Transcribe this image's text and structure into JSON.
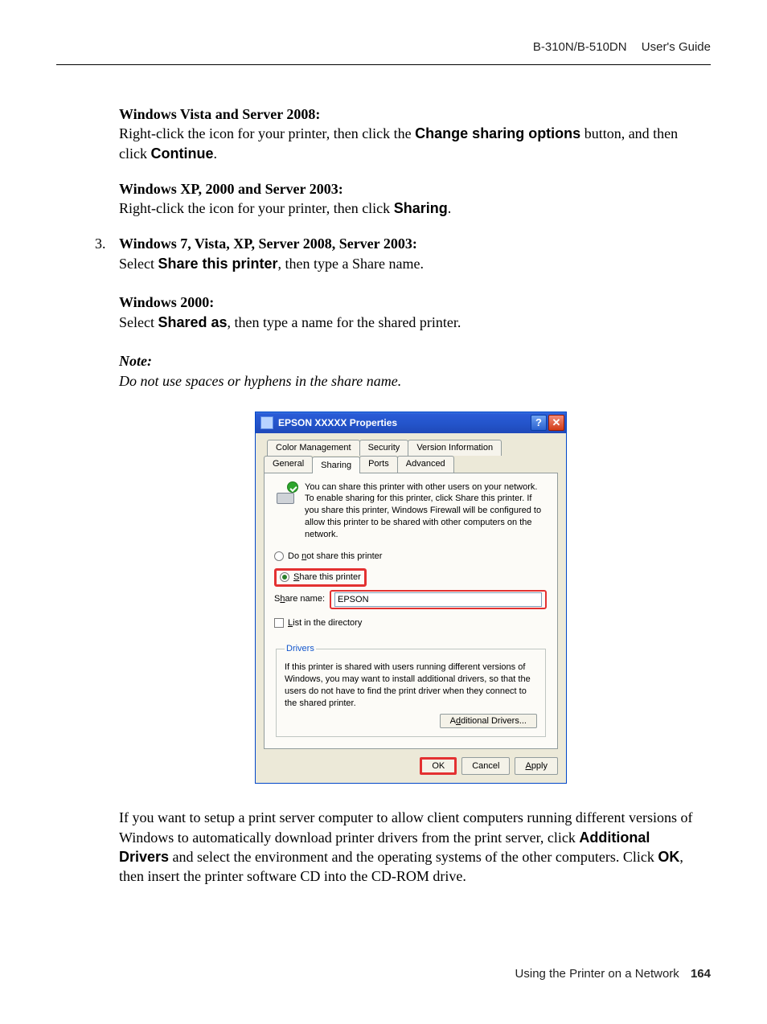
{
  "header": {
    "product": "B-310N/B-510DN",
    "title": "User's Guide"
  },
  "sectionA": {
    "heading": "Windows Vista and Server 2008:",
    "text_pre": "Right-click the icon for your printer, then click the ",
    "button1": "Change sharing options",
    "text_mid": " button, and then click ",
    "button2": "Continue",
    "text_post": "."
  },
  "sectionB": {
    "heading": "Windows XP, 2000 and Server 2003:",
    "text_pre": "Right-click the icon for your printer, then click ",
    "button1": "Sharing",
    "text_post": "."
  },
  "item3": {
    "number": "3.",
    "headingC": "Windows 7, Vista, XP, Server 2008, Server 2003:",
    "c_pre": "Select ",
    "c_bold": "Share this printer",
    "c_post": ", then type a Share name.",
    "headingD": "Windows 2000:",
    "d_pre": "Select ",
    "d_bold": "Shared as",
    "d_post": ", then type a name for the shared printer.",
    "note_label": "Note:",
    "note_text": "Do not use spaces or hyphens in the share name."
  },
  "dialog": {
    "title": "EPSON  XXXXX  Properties",
    "tabs_row1": [
      "Color Management",
      "Security",
      "Version Information"
    ],
    "tabs_row2": [
      "General",
      "Sharing",
      "Ports",
      "Advanced"
    ],
    "intro": "You can share this printer with other users on your network.  To enable sharing for this printer, click Share this printer.  If you share this printer, Windows Firewall will be configured to allow this printer to be shared with other computers on the network.",
    "radio_no": "Do not share this printer",
    "radio_share": "Share this printer",
    "share_label": "Share name:",
    "share_value": "EPSON",
    "list_dir": "List in the directory",
    "drivers_legend": "Drivers",
    "drivers_text": "If this printer is shared with users running different versions of Windows, you may want to install additional drivers, so that the users do not have to find the print driver when they connect to the shared printer.",
    "btn_additional": "Additional Drivers...",
    "btn_ok": "OK",
    "btn_cancel": "Cancel",
    "btn_apply": "Apply"
  },
  "after": {
    "p1_a": "If you want to setup a print server computer to allow client computers running different versions of Windows to automatically download printer drivers from the print server, click ",
    "p1_b1": "Additional Drivers",
    "p1_c": " and select the environment and the operating systems of the other computers. Click ",
    "p1_b2": "OK",
    "p1_d": ", then insert the printer software CD into the CD-ROM drive."
  },
  "footer": {
    "section": "Using the Printer on a Network",
    "page": "164"
  }
}
